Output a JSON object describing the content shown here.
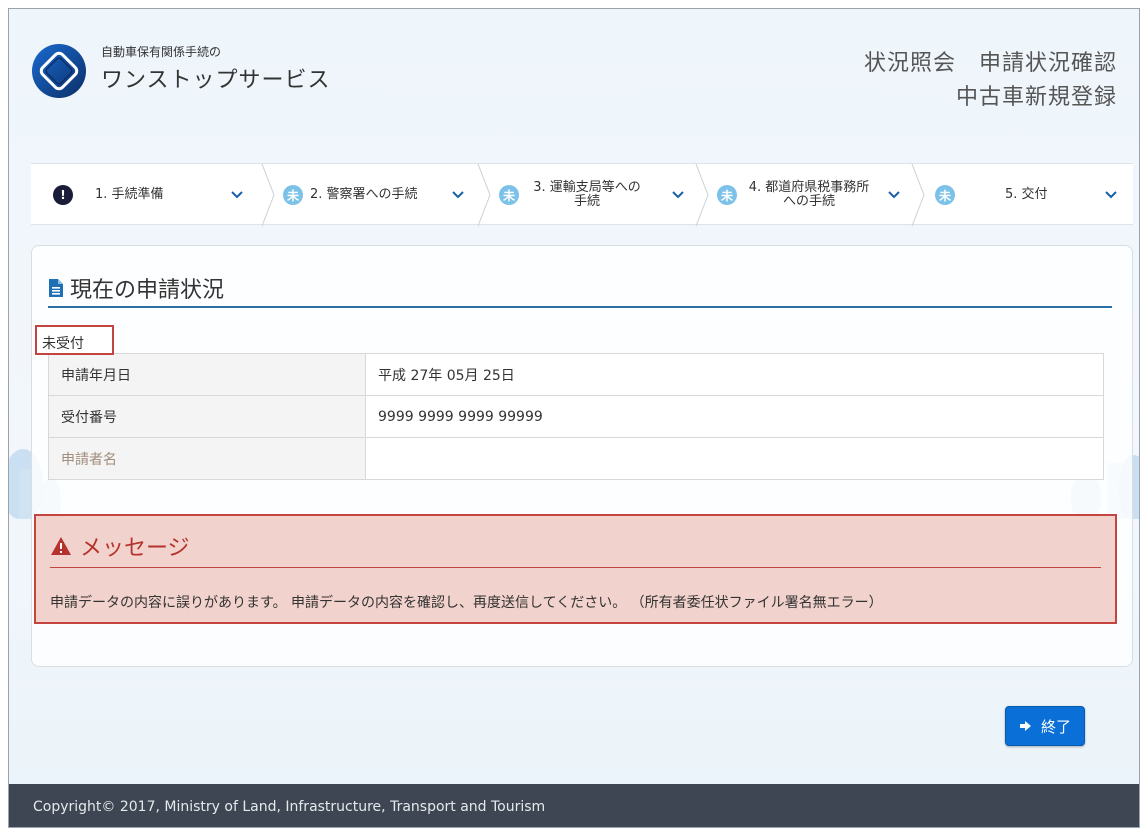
{
  "header": {
    "logo_line1": "自動車保有関係手続の",
    "logo_line2": "ワンストップサービス",
    "title_line1": "状況照会　申請状況確認",
    "title_line2": "中古車新規登録"
  },
  "steps": [
    {
      "label": "1. 手続準備",
      "status": "error",
      "badge": "!"
    },
    {
      "label": "2. 警察署への手続",
      "status": "pending",
      "badge": "未"
    },
    {
      "label": "3. 運輸支局等への手続",
      "status": "pending",
      "badge": "未"
    },
    {
      "label": "4. 都道府県税事務所への手続",
      "status": "pending",
      "badge": "未"
    },
    {
      "label": "5. 交付",
      "status": "pending",
      "badge": "未"
    }
  ],
  "panel": {
    "title": "現在の申請状況",
    "status_label": "未受付",
    "rows": [
      {
        "key": "申請年月日",
        "value": "平成 27年 05月 25日"
      },
      {
        "key": "受付番号",
        "value": "9999 9999 9999 99999"
      },
      {
        "key": "申請者名",
        "value": ""
      }
    ]
  },
  "message": {
    "title": "メッセージ",
    "text": "申請データの内容に誤りがあります。 申請データの内容を確認し、再度送信してください。 （所有者委任状ファイル署名無エラー）"
  },
  "end_button": {
    "label": "終了"
  },
  "footer": {
    "copyright": "Copyright© 2017, Ministry of Land, Infrastructure, Transport and Tourism"
  },
  "colors": {
    "accent": "#0a6fd6",
    "error": "#c4453f",
    "footer_bg": "#3d4652",
    "pending_badge": "#7cc2e8"
  }
}
